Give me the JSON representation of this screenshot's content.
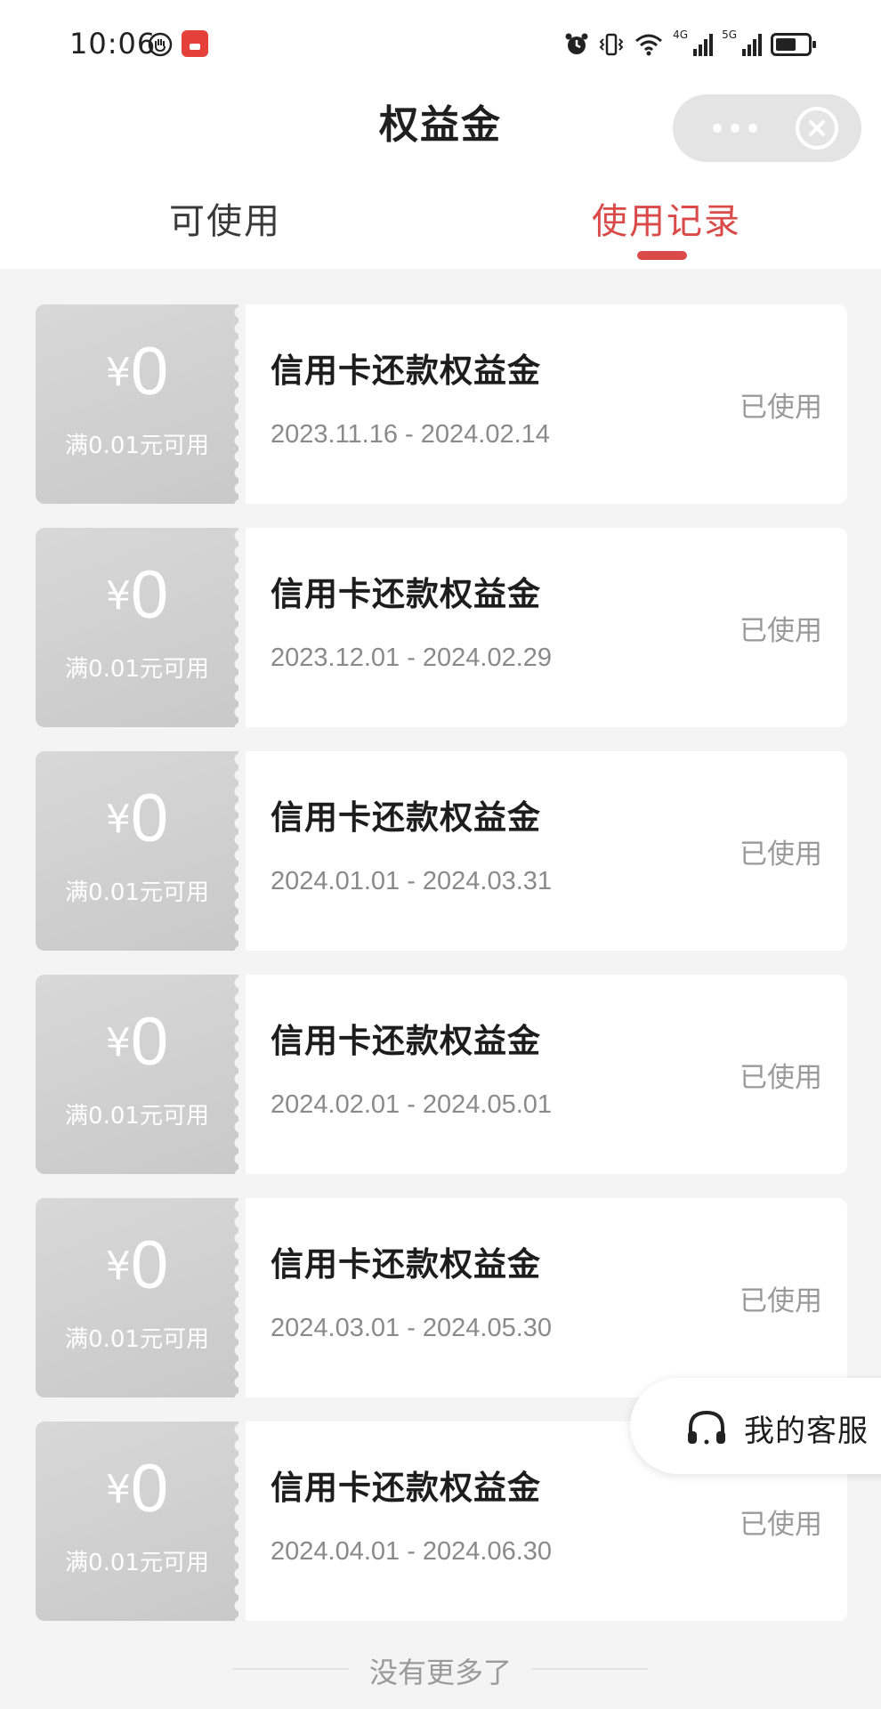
{
  "status_bar": {
    "time": "10:06",
    "network_1": "4G",
    "network_2": "5G"
  },
  "header": {
    "title": "权益金",
    "more_icon": "more-dots-icon",
    "close_icon": "close-circle-icon"
  },
  "tabs": [
    {
      "label": "可使用",
      "active": false
    },
    {
      "label": "使用记录",
      "active": true
    }
  ],
  "coupons": [
    {
      "currency": "¥",
      "amount": "0",
      "condition": "满0.01元可用",
      "title": "信用卡还款权益金",
      "date_range": "2023.11.16 - 2024.02.14",
      "status": "已使用"
    },
    {
      "currency": "¥",
      "amount": "0",
      "condition": "满0.01元可用",
      "title": "信用卡还款权益金",
      "date_range": "2023.12.01 - 2024.02.29",
      "status": "已使用"
    },
    {
      "currency": "¥",
      "amount": "0",
      "condition": "满0.01元可用",
      "title": "信用卡还款权益金",
      "date_range": "2024.01.01 - 2024.03.31",
      "status": "已使用"
    },
    {
      "currency": "¥",
      "amount": "0",
      "condition": "满0.01元可用",
      "title": "信用卡还款权益金",
      "date_range": "2024.02.01 - 2024.05.01",
      "status": "已使用"
    },
    {
      "currency": "¥",
      "amount": "0",
      "condition": "满0.01元可用",
      "title": "信用卡还款权益金",
      "date_range": "2024.03.01 - 2024.05.30",
      "status": "已使用"
    },
    {
      "currency": "¥",
      "amount": "0",
      "condition": "满0.01元可用",
      "title": "信用卡还款权益金",
      "date_range": "2024.04.01 - 2024.06.30",
      "status": "已使用"
    }
  ],
  "footer": {
    "end_text": "没有更多了"
  },
  "customer_service": {
    "label": "我的客服",
    "icon": "headset-icon"
  },
  "colors": {
    "accent": "#d94a48",
    "coupon_stub": "#cfcfcf",
    "muted_text": "#9a9a9a"
  }
}
